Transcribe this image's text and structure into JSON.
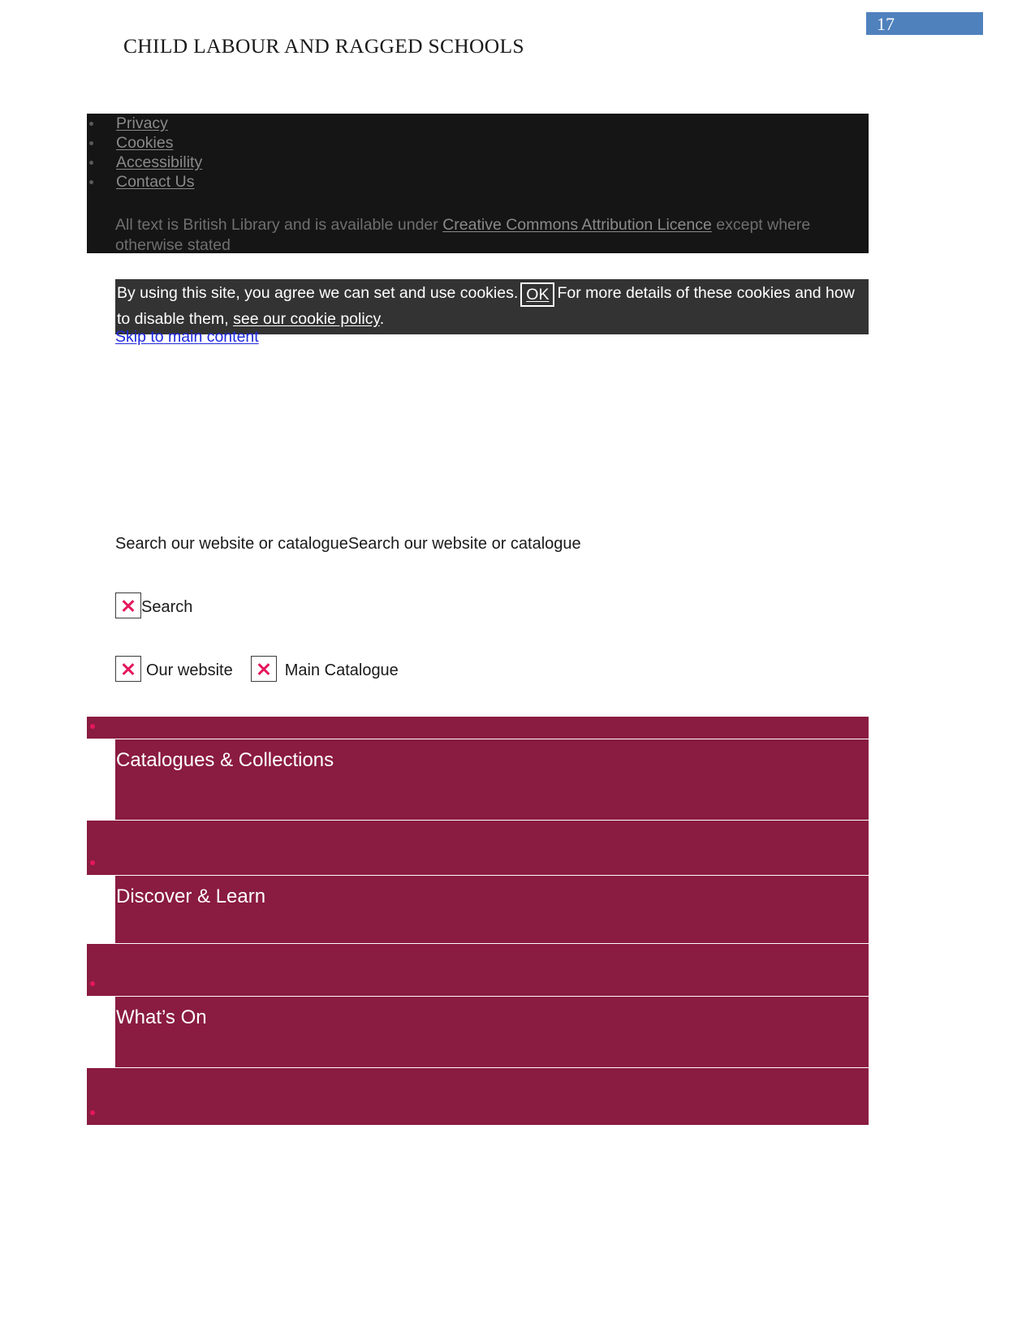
{
  "document": {
    "running_header": "CHILD LABOUR AND RAGGED SCHOOLS",
    "page_number": "17",
    "page_number_bg": "#4f81bd"
  },
  "footer_panel": {
    "background": "#151515",
    "links": [
      {
        "label": "Privacy"
      },
      {
        "label": "Cookies"
      },
      {
        "label": "Accessibility"
      },
      {
        "label": "Contact Us"
      }
    ],
    "attribution": {
      "before": "All text is British Library and is available under ",
      "link": "Creative Commons Attribution Licence",
      "after": " except where otherwise stated"
    }
  },
  "cookie_notice": {
    "background": "#333333",
    "text_before_ok": "By using this site, you agree we can set and use cookies.",
    "ok_label": "OK",
    "text_after_ok": "For more details of these cookies and how to disable them, ",
    "policy_link": "see our cookie policy",
    "trailing": "."
  },
  "skip_link": {
    "label": "Skip to main content",
    "color": "#1f29dd"
  },
  "search": {
    "caption": "Search our website or catalogueSearch our website or catalogue",
    "toggle_label": "Search",
    "toggle_icon": "broken-image-icon",
    "scopes": [
      {
        "label": "Our website",
        "icon": "broken-image-icon"
      },
      {
        "label": "Main Catalogue",
        "icon": "broken-image-icon"
      }
    ]
  },
  "main_nav": {
    "background": "#8a1b41",
    "bullet_color": "#e5175e",
    "items": [
      {
        "label": "Catalogues & Collections"
      },
      {
        "label": "Discover & Learn"
      },
      {
        "label": "What’s On"
      },
      {
        "label": ""
      }
    ]
  }
}
